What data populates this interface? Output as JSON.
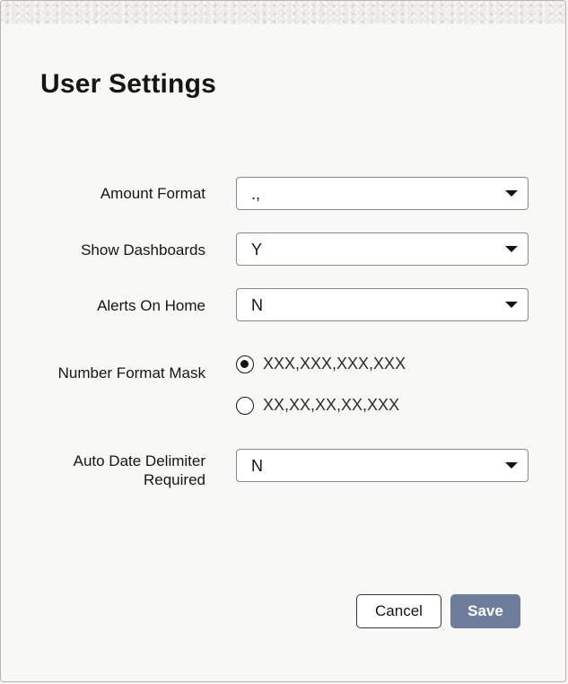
{
  "dialog": {
    "title": "User Settings"
  },
  "fields": {
    "amount_format": {
      "label": "Amount Format",
      "value": ".,"
    },
    "show_dashboards": {
      "label": "Show Dashboards",
      "value": "Y"
    },
    "alerts_on_home": {
      "label": "Alerts On Home",
      "value": "N"
    },
    "number_format_mask": {
      "label": "Number Format Mask",
      "options": [
        {
          "label": "XXX,XXX,XXX,XXX",
          "selected": true
        },
        {
          "label": "XX,XX,XX,XX,XXX",
          "selected": false
        }
      ]
    },
    "auto_date_delimiter": {
      "label_line1": "Auto Date Delimiter",
      "label_line2": "Required",
      "value": "N"
    }
  },
  "buttons": {
    "cancel": "Cancel",
    "save": "Save"
  },
  "colors": {
    "primary_button": "#6e7d9c",
    "text": "#161513",
    "border": "#8c8985"
  },
  "icons": {
    "dropdown": "caret-down-icon",
    "radio_selected": "radio-checked-icon",
    "radio_unselected": "radio-unchecked-icon"
  }
}
